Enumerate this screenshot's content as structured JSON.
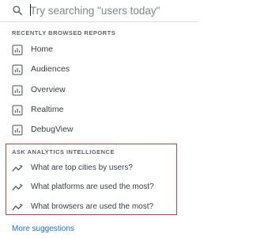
{
  "search": {
    "placeholder": "Try searching \"users today\""
  },
  "recent": {
    "title": "RECENTLY BROWSED REPORTS",
    "items": [
      {
        "label": "Home",
        "icon": "report-chart-icon"
      },
      {
        "label": "Audiences",
        "icon": "report-chart-icon"
      },
      {
        "label": "Overview",
        "icon": "report-chart-icon"
      },
      {
        "label": "Realtime",
        "icon": "report-chart-icon"
      },
      {
        "label": "DebugView",
        "icon": "report-chart-icon"
      }
    ]
  },
  "intelligence": {
    "title": "ASK ANALYTICS INTELLIGENCE",
    "highlight_color": "#e53935",
    "items": [
      {
        "label": "What are top cities by users?",
        "icon": "insights-sparkline-icon"
      },
      {
        "label": "What platforms are used the most?",
        "icon": "insights-sparkline-icon"
      },
      {
        "label": "What browsers are used the most?",
        "icon": "insights-sparkline-icon"
      }
    ]
  },
  "more_suggestions": {
    "label": "More suggestions",
    "color": "#1a73e8"
  }
}
